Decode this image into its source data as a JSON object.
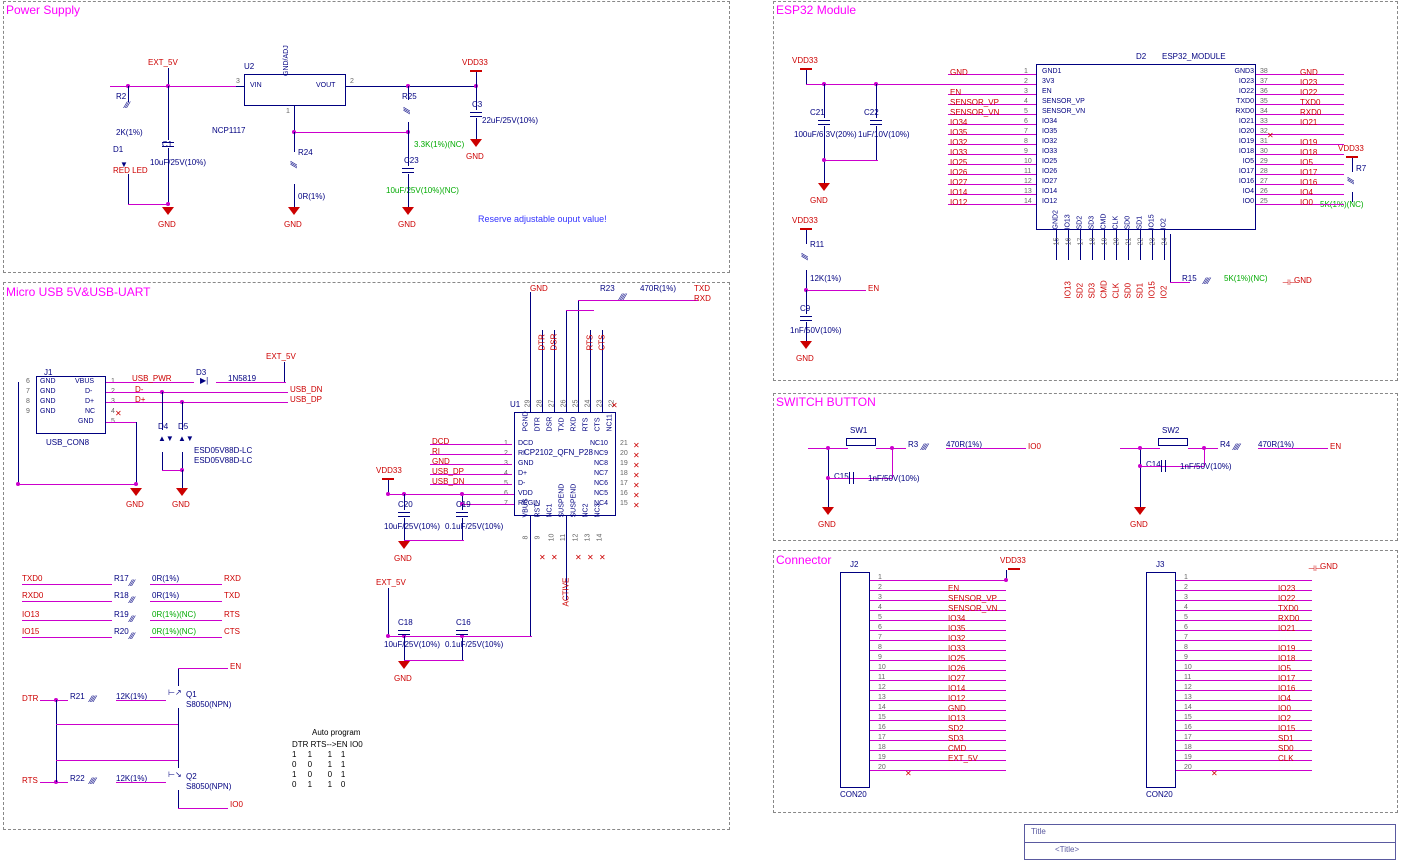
{
  "sections": {
    "power": "Power Supply",
    "usb": "Micro USB  5V&USB-UART",
    "esp32": "ESP32 Module",
    "switch": "SWITCH BUTTON",
    "connector": "Connector"
  },
  "power": {
    "ext5v": "EXT_5V",
    "vdd33": "VDD33",
    "gnd": "GND",
    "r2": "R2",
    "r2v": "2K(1%)",
    "d1": "D1",
    "d1v": "RED LED",
    "c1": "C1",
    "c1v": "10uF/25V(10%)",
    "u2": "U2",
    "u2v": "NCP1117",
    "vin": "VIN",
    "vout": "VOUT",
    "gndadj": "GND/ADJ",
    "pin1": "1",
    "pin2": "2",
    "pin3": "3",
    "r25": "R25",
    "r25v": "3.3K(1%)(NC)",
    "r24": "R24",
    "r24v": "0R(1%)",
    "c23": "C23",
    "c23v": "10uF/25V(10%)(NC)",
    "c3": "C3",
    "c3v": "22uF/25V(10%)",
    "note": "Reserve adjustable ouput value!"
  },
  "usb": {
    "j1": "J1",
    "j1v": "USB_CON8",
    "pins": {
      "vbus": "VBUS",
      "dm": "D-",
      "dp": "D+",
      "nc": "NC",
      "gnd": "GND"
    },
    "pn": {
      "p1": "1",
      "p2": "2",
      "p3": "3",
      "p4": "4",
      "p5": "5",
      "p6": "6",
      "p7": "7",
      "p8": "8",
      "p9": "9"
    },
    "usb_pwr": "USB_PWR",
    "d3": "D3",
    "d3v": "1N5819",
    "usb_dn": "USB_DN",
    "usb_dp": "USB_DP",
    "ext5v": "EXT_5V",
    "d4": "D4",
    "d5": "D5",
    "esd": "ESD05V88D-LC",
    "vdd33": "VDD33",
    "u1": "U1",
    "u1v": "CP2102_QFN_P28",
    "u1pins_left": {
      "dcd": "DCD",
      "ri": "RI",
      "gnd": "GND",
      "dp": "D+",
      "dm": "D-",
      "vdd": "VDD",
      "regin": "REGIN"
    },
    "u1pl_num": {
      "p1": "1",
      "p2": "2",
      "p3": "3",
      "p4": "4",
      "p5": "5",
      "p6": "6",
      "p7": "7"
    },
    "u1top": {
      "pgnd": "PGND",
      "dtr": "DTR",
      "dsr": "DSR",
      "txd": "TXD",
      "rxd": "RXD",
      "rts": "RTS",
      "cts": "CTS",
      "nc11": "NC11"
    },
    "u1top_num": {
      "p29": "29",
      "p28": "28",
      "p27": "27",
      "p26": "26",
      "p25": "25",
      "p24": "24",
      "p23": "23",
      "p22": "22"
    },
    "u1right": {
      "nc10": "NC10",
      "nc9": "NC9",
      "nc8": "NC8",
      "nc7": "NC7",
      "nc6": "NC6",
      "nc5": "NC5",
      "nc4": "NC4"
    },
    "u1r_num": {
      "p21": "21",
      "p20": "20",
      "p19": "19",
      "p18": "18",
      "p17": "17",
      "p16": "16",
      "p15": "15"
    },
    "u1bot": {
      "vbus": "VBUS",
      "rst": "RST",
      "nc1": "NC1",
      "susp": "SUSPEND",
      "susp2": "SUSPEND",
      "nc2": "NC2",
      "nc3": "NC3"
    },
    "u1b_num": {
      "p8": "8",
      "p9": "9",
      "p10": "10",
      "p11": "11",
      "p12": "12",
      "p13": "13",
      "p14": "14"
    },
    "c20": "C20",
    "c20v": "10uF/25V(10%)",
    "c19": "C19",
    "c19v": "0.1uF/25V(10%)",
    "c18": "C18",
    "c18v": "10uF/25V(10%)",
    "c16": "C16",
    "c16v": "0.1uF/25V(10%)",
    "r23": "R23",
    "r23v": "470R(1%)",
    "txd": "TXD",
    "rxd": "RXD",
    "dtr": "DTR",
    "dsr": "DSR",
    "rts": "RTS",
    "cts": "CTS",
    "active": "ACTIVE",
    "txd0": "TXD0",
    "rxd0": "RXD0",
    "io13": "IO13",
    "io15": "IO15",
    "r17": "R17",
    "r18": "R18",
    "r19": "R19",
    "r20": "R20",
    "r0": "0R(1%)",
    "r0nc": "0R(1%)(NC)",
    "r21": "R21",
    "r22": "R22",
    "r12k": "12K(1%)",
    "q1": "Q1",
    "q2": "Q2",
    "qv": "S8050(NPN)",
    "en": "EN",
    "io0": "IO0",
    "autoprog": "Auto program",
    "aphdr": "DTR RTS-->EN IO0",
    "ap1": "1     1       1    1",
    "ap2": "0     0       1    1",
    "ap3": "1     0       0    1",
    "ap4": "0     1       1    0",
    "gnd": "GND"
  },
  "esp32": {
    "vdd33": "VDD33",
    "gnd": "GND",
    "c21": "C21",
    "c21v": "100uF/6.3V(20%)",
    "c22": "C22",
    "c22v": "1uF/10V(10%)",
    "d2": "D2",
    "d2v": "ESP32_MODULE",
    "left": {
      "p1": {
        "n": "1",
        "name": "GND1",
        "net": "GND"
      },
      "p2": {
        "n": "2",
        "name": "3V3",
        "net": ""
      },
      "p3": {
        "n": "3",
        "name": "EN",
        "net": "EN"
      },
      "p4": {
        "n": "4",
        "name": "SENSOR_VP",
        "net": "SENSOR_VP"
      },
      "p5": {
        "n": "5",
        "name": "SENSOR_VN",
        "net": "SENSOR_VN"
      },
      "p6": {
        "n": "6",
        "name": "IO34",
        "net": "IO34"
      },
      "p7": {
        "n": "7",
        "name": "IO35",
        "net": "IO35"
      },
      "p8": {
        "n": "8",
        "name": "IO32",
        "net": "IO32"
      },
      "p9": {
        "n": "9",
        "name": "IO33",
        "net": "IO33"
      },
      "p10": {
        "n": "10",
        "name": "IO25",
        "net": "IO25"
      },
      "p11": {
        "n": "11",
        "name": "IO26",
        "net": "IO26"
      },
      "p12": {
        "n": "12",
        "name": "IO27",
        "net": "IO27"
      },
      "p13": {
        "n": "13",
        "name": "IO14",
        "net": "IO14"
      },
      "p14": {
        "n": "14",
        "name": "IO12",
        "net": "IO12"
      }
    },
    "right": {
      "p38": {
        "n": "38",
        "name": "GND3",
        "net": "GND"
      },
      "p37": {
        "n": "37",
        "name": "IO23",
        "net": "IO23"
      },
      "p36": {
        "n": "36",
        "name": "IO22",
        "net": "IO22"
      },
      "p35": {
        "n": "35",
        "name": "TXD0",
        "net": "TXD0"
      },
      "p34": {
        "n": "34",
        "name": "RXD0",
        "net": "RXD0"
      },
      "p33": {
        "n": "33",
        "name": "IO21",
        "net": "IO21"
      },
      "p32": {
        "n": "32",
        "name": "IO20",
        "net": ""
      },
      "p31": {
        "n": "31",
        "name": "IO19",
        "net": "IO19"
      },
      "p30": {
        "n": "30",
        "name": "IO18",
        "net": "IO18"
      },
      "p29": {
        "n": "29",
        "name": "IO5",
        "net": "IO5"
      },
      "p28": {
        "n": "28",
        "name": "IO17",
        "net": "IO17"
      },
      "p27": {
        "n": "27",
        "name": "IO16",
        "net": "IO16"
      },
      "p26": {
        "n": "26",
        "name": "IO4",
        "net": "IO4"
      },
      "p25": {
        "n": "25",
        "name": "IO0",
        "net": "IO0"
      }
    },
    "bottom": {
      "p15": {
        "n": "15",
        "name": "GND2"
      },
      "p16": {
        "n": "16",
        "name": "IO13",
        "net": "IO13"
      },
      "p17": {
        "n": "17",
        "name": "SD2",
        "net": "SD2"
      },
      "p18": {
        "n": "18",
        "name": "SD3",
        "net": "SD3"
      },
      "p19": {
        "n": "19",
        "name": "CMD",
        "net": "CMD"
      },
      "p20": {
        "n": "20",
        "name": "CLK",
        "net": "CLK"
      },
      "p21": {
        "n": "21",
        "name": "SD0",
        "net": "SD0"
      },
      "p22": {
        "n": "22",
        "name": "SD1",
        "net": "SD1"
      },
      "p23": {
        "n": "23",
        "name": "IO15",
        "net": "IO15"
      },
      "p24": {
        "n": "24",
        "name": "IO2",
        "net": "IO2"
      }
    },
    "r11": "R11",
    "r11v": "12K(1%)",
    "c9": "C9",
    "c9v": "1nF/50V(10%)",
    "en": "EN",
    "r15": "R15",
    "r15v": "5K(1%)(NC)",
    "r7": "R7",
    "r7v": "5K(1%)(NC)"
  },
  "switch": {
    "sw1": "SW1",
    "sw2": "SW2",
    "r3": "R3",
    "r4": "R4",
    "rv": "470R(1%)",
    "io0": "IO0",
    "en": "EN",
    "c15": "C15",
    "c14": "C14",
    "cv": "1nF/50V(10%)",
    "gnd": "GND"
  },
  "connector": {
    "j2": "J2",
    "j3": "J3",
    "con20": "CON20",
    "vdd33": "VDD33",
    "gnd": "GND",
    "j2pins": [
      "",
      "EN",
      "SENSOR_VP",
      "SENSOR_VN",
      "IO34",
      "IO35",
      "IO32",
      "IO33",
      "IO25",
      "IO26",
      "IO27",
      "IO14",
      "IO12",
      "GND",
      "IO13",
      "SD2",
      "SD3",
      "CMD",
      "EXT_5V",
      ""
    ],
    "j3pins": [
      "",
      "IO23",
      "IO22",
      "TXD0",
      "RXD0",
      "IO21",
      "",
      "IO19",
      "IO18",
      "IO5",
      "IO17",
      "IO16",
      "IO4",
      "IO0",
      "IO2",
      "IO15",
      "SD1",
      "SD0",
      "CLK",
      ""
    ]
  },
  "titleblock": {
    "title": "Title",
    "val": "<Title>"
  }
}
